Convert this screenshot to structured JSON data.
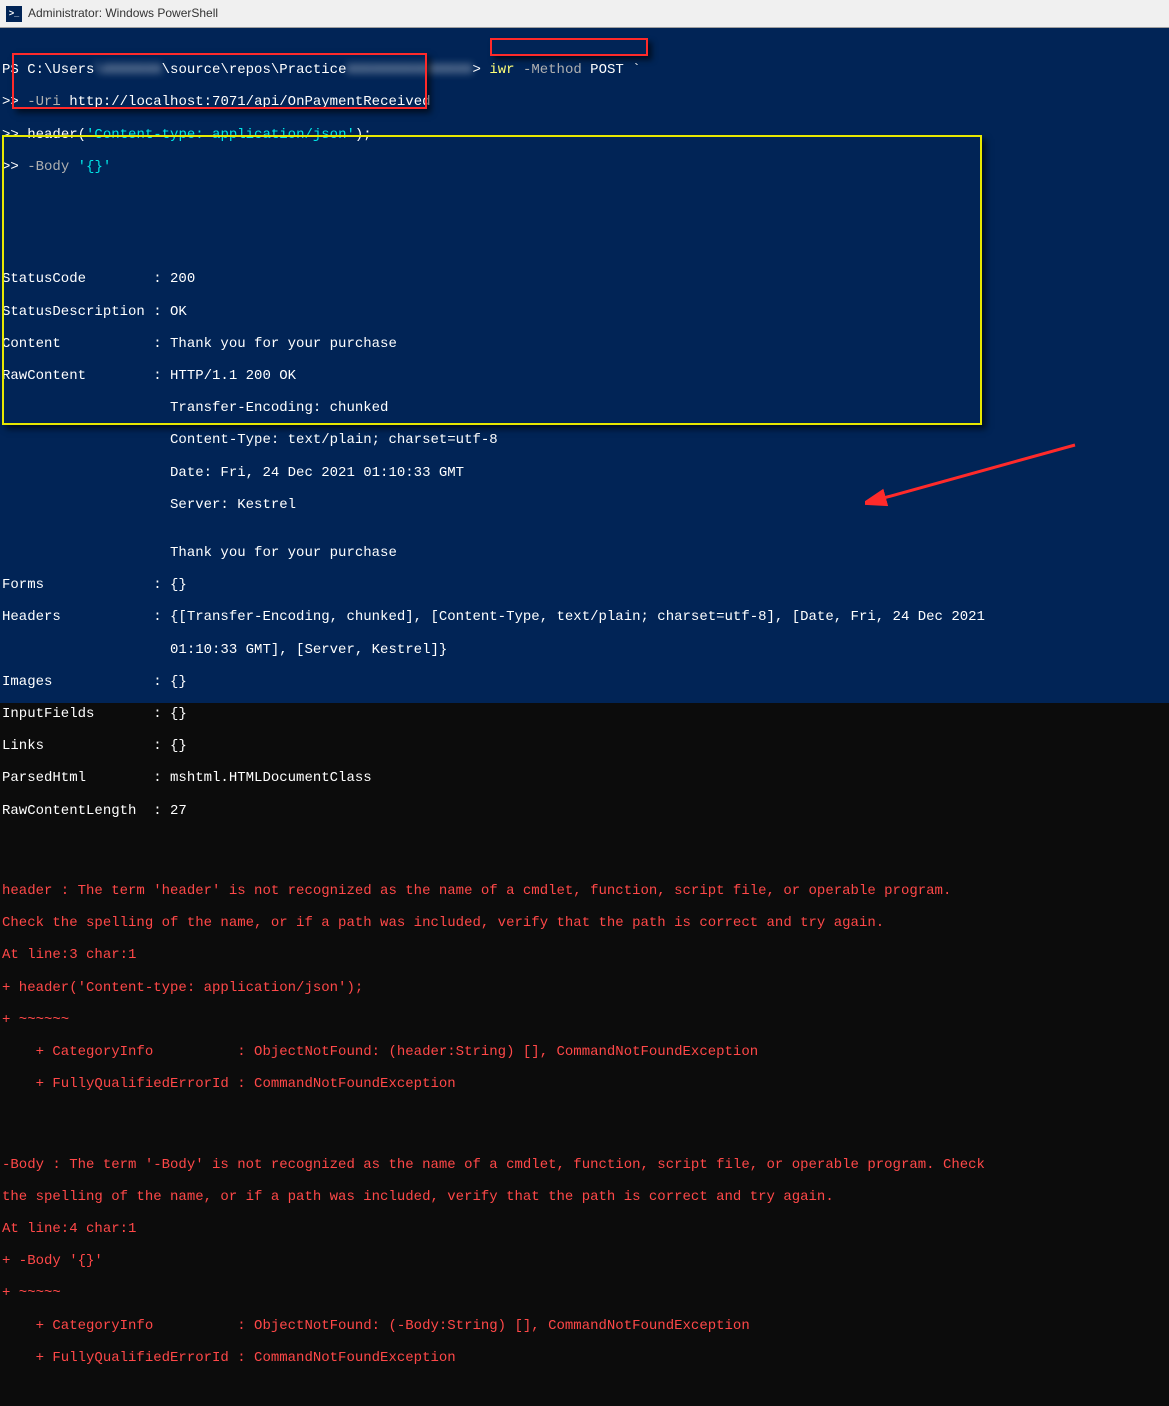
{
  "title": "Administrator: Windows PowerShell",
  "prompt": {
    "pathStart": "PS C:\\Users",
    "pathMid": "\\source\\repos\\Practice",
    "caret": "> ",
    "iwr": "iwr",
    "method": " -Method ",
    "post": "POST ",
    "tick": "`"
  },
  "cmdLines": {
    "cont": ">> ",
    "uriFlag": "-Uri ",
    "uri": "http://localhost:7071/api/OnPaymentReceived",
    "headerCall": "header(",
    "headerStr": "'Content-type: application/json'",
    "headerEnd": ");",
    "bodyFlag": "-Body ",
    "bodyStr": "'{}'"
  },
  "response": {
    "l1": "StatusCode        : 200",
    "l2": "StatusDescription : OK",
    "l3": "Content           : Thank you for your purchase",
    "l4": "RawContent        : HTTP/1.1 200 OK",
    "l5": "                    Transfer-Encoding: chunked",
    "l6": "                    Content-Type: text/plain; charset=utf-8",
    "l7": "                    Date: Fri, 24 Dec 2021 01:10:33 GMT",
    "l8": "                    Server: Kestrel",
    "l9": "",
    "l10": "                    Thank you for your purchase",
    "l11": "Forms             : {}",
    "l12": "Headers           : {[Transfer-Encoding, chunked], [Content-Type, text/plain; charset=utf-8], [Date, Fri, 24 Dec 2021",
    "l13": "                    01:10:33 GMT], [Server, Kestrel]}",
    "l14": "Images            : {}",
    "l15": "InputFields       : {}",
    "l16": "Links             : {}",
    "l17": "ParsedHtml        : mshtml.HTMLDocumentClass",
    "l18": "RawContentLength  : 27"
  },
  "error1": {
    "a": "header : The term 'header' is not recognized as the name of a cmdlet, function, script file, or operable program.",
    "b": "Check the spelling of the name, or if a path was included, verify that the path is correct and try again.",
    "c": "At line:3 char:1",
    "d": "+ header('Content-type: application/json');",
    "e": "+ ~~~~~~",
    "f": "    + CategoryInfo          : ObjectNotFound: (header:String) [], CommandNotFoundException",
    "g": "    + FullyQualifiedErrorId : CommandNotFoundException"
  },
  "error2": {
    "a": "-Body : The term '-Body' is not recognized as the name of a cmdlet, function, script file, or operable program. Check",
    "b": "the spelling of the name, or if a path was included, verify that the path is correct and try again.",
    "c": "At line:4 char:1",
    "d": "+ -Body '{}'",
    "e": "+ ~~~~~",
    "f": "    + CategoryInfo          : ObjectNotFound: (-Body:String) [], CommandNotFoundException",
    "g": "    + FullyQualifiedErrorId : CommandNotFoundException"
  }
}
